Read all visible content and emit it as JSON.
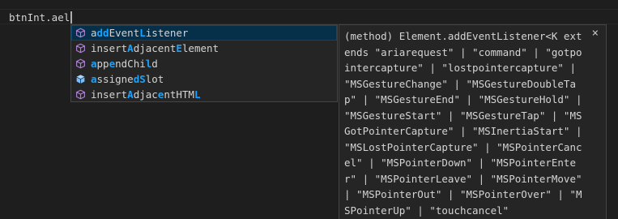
{
  "editor": {
    "line_text": "btnInt.ael"
  },
  "suggestions": [
    {
      "label": "addEventListener",
      "kind": "method",
      "match": [
        0,
        1,
        1,
        0,
        0,
        0,
        0,
        0,
        1,
        0,
        0,
        0,
        0,
        0,
        0,
        0
      ]
    },
    {
      "label": "insertAdjacentElement",
      "kind": "method",
      "match": [
        0,
        0,
        0,
        0,
        0,
        0,
        1,
        0,
        0,
        0,
        0,
        0,
        0,
        0,
        1,
        0,
        0,
        0,
        0,
        0,
        0
      ]
    },
    {
      "label": "appendChild",
      "kind": "method",
      "match": [
        1,
        0,
        0,
        1,
        0,
        0,
        0,
        0,
        0,
        1,
        0
      ]
    },
    {
      "label": "assignedSlot",
      "kind": "property",
      "match": [
        1,
        0,
        0,
        0,
        0,
        0,
        0,
        1,
        1,
        0,
        0,
        0
      ]
    },
    {
      "label": "insertAdjacentHTML",
      "kind": "method",
      "match": [
        0,
        0,
        0,
        0,
        0,
        0,
        1,
        0,
        0,
        0,
        0,
        1,
        0,
        0,
        0,
        0,
        0,
        1
      ]
    }
  ],
  "selected_index": 0,
  "details": {
    "close_label": "×",
    "signature": "(method) Element.addEventListener<K extends \"ariarequest\" | \"command\" | \"gotpointercapture\" | \"lostpointercapture\" | \"MSGestureChange\" | \"MSGestureDoubleTap\" | \"MSGestureEnd\" | \"MSGestureHold\" | \"MSGestureStart\" | \"MSGestureTap\" | \"MSGotPointerCapture\" | \"MSInertiaStart\" | \"MSLostPointerCapture\" | \"MSPointerCancel\" | \"MSPointerDown\" | \"MSPointerEnter\" | \"MSPointerLeave\" | \"MSPointerMove\" | \"MSPointerOut\" | \"MSPointerOver\" | \"MSPointerUp\" | \"touchcancel\""
  },
  "colors": {
    "method_icon": "#b180d7",
    "property_icon": "#75beff",
    "match_highlight": "#18a3ff",
    "selection_bg": "#062f4a"
  }
}
